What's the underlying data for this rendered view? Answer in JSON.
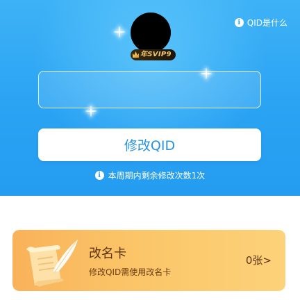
{
  "header": {
    "help_link_label": "QID是什么",
    "help_icon": "info-icon"
  },
  "profile": {
    "avatar": "avatar",
    "vip_badge": "年SVIP9",
    "vip_icon": "crown-icon"
  },
  "qid_field": {
    "value": "",
    "placeholder": ""
  },
  "modify_button": {
    "label": "修改QID"
  },
  "notice": {
    "text": "本周期内剩余修改次数1次",
    "icon": "info-icon"
  },
  "rename_card": {
    "title": "改名卡",
    "description": "修改QID需使用改名卡",
    "count": "0张>",
    "icon": "scroll-quill-icon"
  },
  "colors": {
    "hero_blue": "#2aa3f3",
    "button_text": "#2a93e0",
    "card_orange": "#fbc568",
    "card_text": "#5a3210"
  }
}
